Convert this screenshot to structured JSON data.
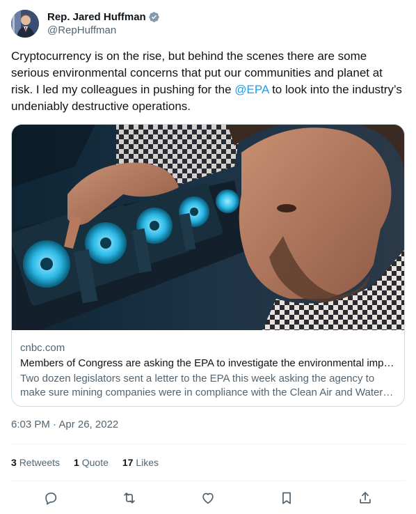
{
  "author": {
    "display_name": "Rep. Jared Huffman",
    "handle": "@RepHuffman",
    "avatar_icon": "profile-photo",
    "verified_icon": "verified-badge-icon",
    "verified_color": "#829aab"
  },
  "tweet": {
    "text_before": "Cryptocurrency is on the rise, but behind the scenes there are some serious environmental concerns that put our communities and planet at risk. I led my colleagues in pushing for the ",
    "mention": "@EPA",
    "text_after": " to look into the industry’s undeniably destructive operations.",
    "link_color": "#1d9bf0"
  },
  "card": {
    "image_icon": "crypto-mining-rig-photo",
    "domain": "cnbc.com",
    "title": "Members of Congress are asking the EPA to investigate the environmental impact of cryptocurrency mining",
    "description": "Two dozen legislators sent a letter to the EPA this week asking the agency to make sure mining companies were in compliance with the Clean Air and Water Acts."
  },
  "timestamp": "6:03 PM · Apr 26, 2022",
  "stats": {
    "retweets_count": "3",
    "retweets_label": "Retweets",
    "quotes_count": "1",
    "quotes_label": "Quote",
    "likes_count": "17",
    "likes_label": "Likes"
  },
  "actions": [
    {
      "name": "reply",
      "icon": "reply-icon"
    },
    {
      "name": "retweet",
      "icon": "retweet-icon"
    },
    {
      "name": "like",
      "icon": "heart-icon"
    },
    {
      "name": "bookmark",
      "icon": "bookmark-icon"
    },
    {
      "name": "share",
      "icon": "share-icon"
    }
  ]
}
